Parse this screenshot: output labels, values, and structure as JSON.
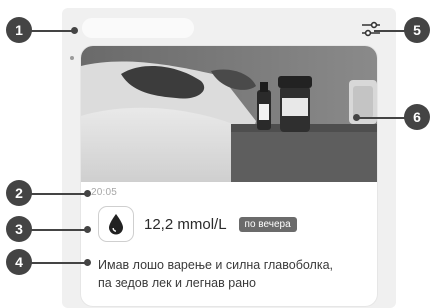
{
  "entry": {
    "time": "20:05",
    "reading_value": "12,2 mmol/L",
    "meal_tag": "по вечера",
    "note_line1": "Имав лошо варење и силна главоболка,",
    "note_line2": "па зедов лек и легнав рано"
  },
  "callouts": [
    "1",
    "2",
    "3",
    "4",
    "5",
    "6"
  ],
  "icons": {
    "filter": "sliders-icon",
    "reading": "blood-drop-icon"
  }
}
